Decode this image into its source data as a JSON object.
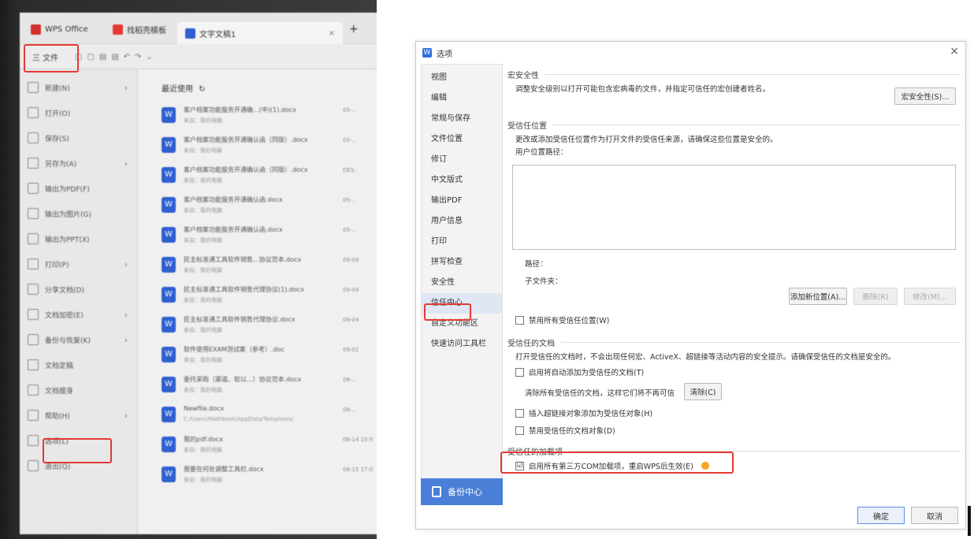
{
  "photo": {
    "tabs": [
      {
        "label": "WPS Office",
        "color": "#d32f2f"
      },
      {
        "label": "找稻壳模板",
        "color": "#e53935"
      },
      {
        "label": "文字文稿1",
        "color": "#2f5fd0"
      }
    ],
    "tab_close": "×",
    "tab_add": "+",
    "toolbar_file_label": "三 文件",
    "menu": [
      {
        "label": "新建(N)",
        "arrow": "›"
      },
      {
        "label": "打开(O)",
        "arrow": ""
      },
      {
        "label": "保存(S)",
        "arrow": ""
      },
      {
        "label": "另存为(A)",
        "arrow": "›"
      },
      {
        "label": "输出为PDF(F)",
        "arrow": ""
      },
      {
        "label": "输出为图片(G)",
        "arrow": ""
      },
      {
        "label": "输出为PPT(X)",
        "arrow": ""
      },
      {
        "label": "打印(P)",
        "arrow": "›"
      },
      {
        "label": "分享文档(D)",
        "arrow": ""
      },
      {
        "label": "文档加密(E)",
        "arrow": "›"
      },
      {
        "label": "备份与恢复(K)",
        "arrow": "›"
      },
      {
        "label": "文档定稿",
        "arrow": ""
      },
      {
        "label": "文档瘦身",
        "arrow": ""
      },
      {
        "label": "帮助(H)",
        "arrow": "›"
      },
      {
        "label": "选项(L)",
        "arrow": ""
      },
      {
        "label": "退出(Q)",
        "arrow": ""
      }
    ],
    "recent_title": "最近使用",
    "refresh_icon": "↻",
    "files": [
      {
        "name": "客户档案功能服务开通确...(中)(1).docx",
        "sub": "来自：我的电脑",
        "date": "05-.."
      },
      {
        "name": "客户档案功能服务开通确认函（同版）.docx",
        "sub": "来自：我的电脑",
        "date": "05-.."
      },
      {
        "name": "客户档案功能服务开通确认函（同版）.docx",
        "sub": "来自：我的电脑",
        "date": "DES.."
      },
      {
        "name": "客户档案功能服务开通确认函.docx",
        "sub": "来自：我的电脑",
        "date": "05-.."
      },
      {
        "name": "客户档案功能服务开通确认函.docx",
        "sub": "来自：我的电脑",
        "date": "05-.."
      },
      {
        "name": "民主标准通工具软件销售...协议范本.docx",
        "sub": "来自：我的电脑",
        "date": "09-04"
      },
      {
        "name": "民主标准通工具软件销售代理协议(1).docx",
        "sub": "来自：我的电脑",
        "date": "09-04"
      },
      {
        "name": "民主标准通工具软件销售代理协议.docx",
        "sub": "来自：我的电脑",
        "date": "09-04"
      },
      {
        "name": "软件使用EXAM测试案（参考）.doc",
        "sub": "来自：我的电脑",
        "date": "09-01"
      },
      {
        "name": "委托采购（渠道、软以...）协议范本.docx",
        "sub": "来自：我的电脑",
        "date": "08-.."
      },
      {
        "name": "Newfile.docx",
        "sub": "C:/Users/Mathbook/AppData/Templates/",
        "date": "08-.."
      },
      {
        "name": "我的pdf.docx",
        "sub": "来自：我的电脑",
        "date": "08-14 15:5"
      },
      {
        "name": "我要在何处调整工具栏.docx",
        "sub": "来自：我的电脑",
        "date": "08-15 17:0"
      }
    ]
  },
  "dialog": {
    "title": "选项",
    "close_label": "×",
    "nav": [
      "视图",
      "编辑",
      "常规与保存",
      "文件位置",
      "修订",
      "中文版式",
      "输出PDF",
      "用户信息",
      "打印",
      "拼写检查",
      "安全性",
      "信任中心",
      "自定义功能区",
      "快速访问工具栏"
    ],
    "active_nav_index": 11,
    "backup_label": "备份中心",
    "macro": {
      "heading": "宏安全性",
      "desc": "调整安全级别以打开可能包含宏病毒的文件，并指定可信任的宏创建者姓名。",
      "button": "宏安全性(S)..."
    },
    "trusted_locations": {
      "heading": "受信任位置",
      "desc": "更改或添加受信任位置作为打开文件的受信任来源，请确保这些位置是安全的。",
      "list_label": "用户位置路径：",
      "path_label": "路径：",
      "subfolder_label": "子文件夹：",
      "add_button": "添加新位置(A)...",
      "remove_button": "删除(R)",
      "modify_button": "修改(M)...",
      "disable_checkbox": "禁用所有受信任位置(W)"
    },
    "trusted_docs": {
      "heading": "受信任的文档",
      "desc": "打开受信任的文档时，不会出现任何宏、ActiveX、超链接等活动内容的安全提示。请确保受信任的文档是安全的。",
      "auto_add_checkbox": "启用将自动添加为受信任的文档(T)",
      "clear_desc": "清除所有受信任的文档，这样它们将不再可信",
      "clear_button": "清除(C)",
      "hyperlink_checkbox": "插入超链接对象添加为受信任对象(H)",
      "disable_docs_checkbox": "禁用受信任的文档对象(D)"
    },
    "addins": {
      "heading": "受信任的加载项",
      "checkbox": "启用所有第三方COM加载项，重启WPS后生效(E)",
      "checked": "☑"
    },
    "ok_label": "确定",
    "cancel_label": "取消"
  }
}
